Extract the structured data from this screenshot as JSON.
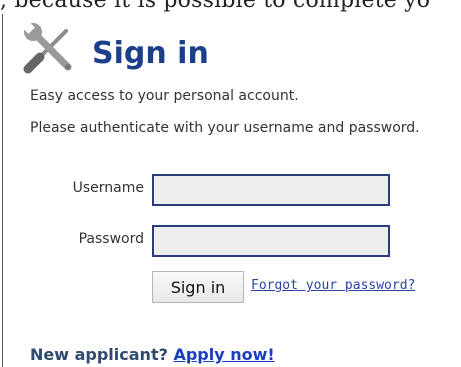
{
  "page_fragment": ", because it is possible to complete yo",
  "header": {
    "title": "Sign in",
    "icon": "tools-icon"
  },
  "intro": "Easy access to your personal account.",
  "instructions": "Please authenticate with your username and password.",
  "form": {
    "username_label": "Username",
    "username_value": "",
    "password_label": "Password",
    "password_value": "",
    "submit_label": "Sign in",
    "forgot_link": "Forgot your password?"
  },
  "footer": {
    "label": "New applicant?",
    "link": "Apply now!"
  },
  "colors": {
    "title": "#1c3f8a",
    "input_border": "#2b3c7d",
    "input_bg": "#eeeeee",
    "link": "#2a44a8"
  }
}
